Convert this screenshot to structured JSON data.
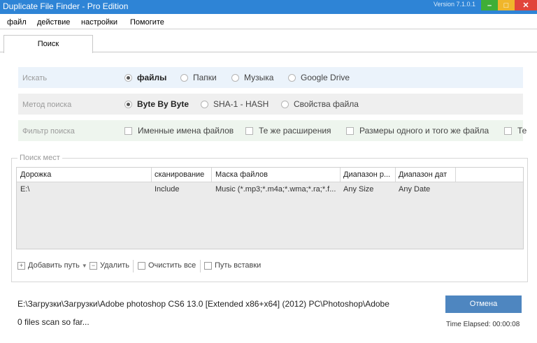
{
  "window": {
    "title": "Duplicate File Finder - Pro Edition",
    "version": "Version 7.1.0.1"
  },
  "menu": [
    "файл",
    "действие",
    "настройки",
    "Помогите"
  ],
  "tabs": [
    {
      "label": "Поиск",
      "active": true
    }
  ],
  "search_options": {
    "search_for": {
      "label": "Искать",
      "options": [
        {
          "label": "файлы",
          "selected": true
        },
        {
          "label": "Папки",
          "selected": false
        },
        {
          "label": "Музыка",
          "selected": false
        },
        {
          "label": "Google Drive",
          "selected": false
        }
      ]
    },
    "method": {
      "label": "Метод поиска",
      "options": [
        {
          "label": "Byte By Byte",
          "selected": true
        },
        {
          "label": "SHA-1 - HASH",
          "selected": false
        },
        {
          "label": "Свойства файла",
          "selected": false
        }
      ]
    },
    "filter": {
      "label": "Фильтр поиска",
      "options": [
        {
          "label": "Именные имена файлов",
          "checked": false
        },
        {
          "label": "Те же расширения",
          "checked": false
        },
        {
          "label": "Размеры одного и того же файла",
          "checked": false
        },
        {
          "label": "Те",
          "checked": false
        }
      ]
    }
  },
  "places": {
    "legend": "Поиск мест",
    "columns": [
      "Дорожка",
      "сканирование",
      "Маска файлов",
      "Диапазон р...",
      "Диапазон дат"
    ],
    "rows": [
      [
        "E:\\",
        "Include",
        "Music (*.mp3;*.m4a;*.wma;*.ra;*.f...",
        "Any Size",
        "Any Date"
      ]
    ]
  },
  "toolbar": {
    "add_path": "Добавить путь",
    "remove": "Удалить",
    "clear_all": "Очистить все",
    "paste_path": "Путь вставки"
  },
  "status": {
    "current_path": "E:\\Загрузки\\Загрузки\\Adobe photoshop CS6 13.0 [Extended x86+x64] (2012) PC\\Photoshop\\Adobe",
    "scan_progress": "0 files scan so far...",
    "elapsed": "Time Elapsed: 00:00:08",
    "cancel_label": "Отмена"
  },
  "colors": {
    "titlebar": "#2e84d6",
    "minimize": "#3fae37",
    "maximize": "#f0b62b",
    "close": "#e1453b",
    "cancel_button": "#4e86c0"
  }
}
